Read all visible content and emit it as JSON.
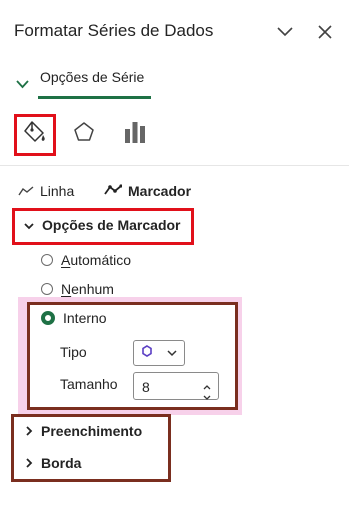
{
  "header": {
    "title": "Formatar Séries de Dados"
  },
  "tabs": {
    "active_label": "Opções de Série"
  },
  "subtabs": {
    "line_label": "Linha",
    "marker_label": "Marcador"
  },
  "marker_options": {
    "heading": "Opções de Marcador",
    "automatic_first": "A",
    "automatic_rest": "utomático",
    "none_first": "N",
    "none_rest": "enhum",
    "internal_label": "Interno",
    "selected": "Interno",
    "type_label": "Tipo",
    "size_label": "Tamanho",
    "size_value": "8"
  },
  "sections": {
    "fill": "Preenchimento",
    "border": "Borda"
  },
  "colors": {
    "accent": "#1e7145",
    "highlight_red": "#e1101a",
    "highlight_brown": "#7a2e1f",
    "highlight_pink": "#f7d1ea"
  },
  "icons": {
    "header": [
      "chevron-down-icon",
      "close-icon"
    ],
    "toolbar": [
      "fill-line-icon",
      "effects-pentagon-icon",
      "series-options-bar-icon"
    ]
  }
}
